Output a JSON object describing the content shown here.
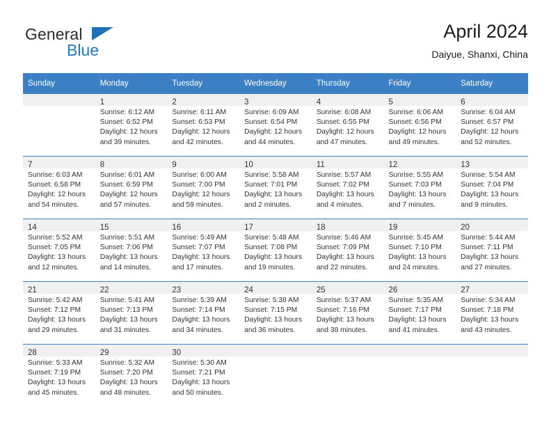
{
  "brand": {
    "line1": "General",
    "line2": "Blue",
    "triangle_icon": "brand-triangle-icon"
  },
  "header": {
    "title": "April 2024",
    "subtitle": "Daiyue, Shanxi, China"
  },
  "colors": {
    "header_blue": "#3b7fc4",
    "brand_blue": "#2079c4",
    "daynum_band": "#f0f0f0",
    "text": "#333333"
  },
  "weekday_headers": [
    "Sunday",
    "Monday",
    "Tuesday",
    "Wednesday",
    "Thursday",
    "Friday",
    "Saturday"
  ],
  "labels": {
    "sunrise_prefix": "Sunrise:",
    "sunset_prefix": "Sunset:",
    "daylight_prefix": "Daylight:"
  },
  "weeks": [
    [
      {
        "day": "",
        "sunrise": "",
        "sunset": "",
        "daylight1": "",
        "daylight2": ""
      },
      {
        "day": "1",
        "sunrise": "Sunrise: 6:12 AM",
        "sunset": "Sunset: 6:52 PM",
        "daylight1": "Daylight: 12 hours",
        "daylight2": "and 39 minutes."
      },
      {
        "day": "2",
        "sunrise": "Sunrise: 6:11 AM",
        "sunset": "Sunset: 6:53 PM",
        "daylight1": "Daylight: 12 hours",
        "daylight2": "and 42 minutes."
      },
      {
        "day": "3",
        "sunrise": "Sunrise: 6:09 AM",
        "sunset": "Sunset: 6:54 PM",
        "daylight1": "Daylight: 12 hours",
        "daylight2": "and 44 minutes."
      },
      {
        "day": "4",
        "sunrise": "Sunrise: 6:08 AM",
        "sunset": "Sunset: 6:55 PM",
        "daylight1": "Daylight: 12 hours",
        "daylight2": "and 47 minutes."
      },
      {
        "day": "5",
        "sunrise": "Sunrise: 6:06 AM",
        "sunset": "Sunset: 6:56 PM",
        "daylight1": "Daylight: 12 hours",
        "daylight2": "and 49 minutes."
      },
      {
        "day": "6",
        "sunrise": "Sunrise: 6:04 AM",
        "sunset": "Sunset: 6:57 PM",
        "daylight1": "Daylight: 12 hours",
        "daylight2": "and 52 minutes."
      }
    ],
    [
      {
        "day": "7",
        "sunrise": "Sunrise: 6:03 AM",
        "sunset": "Sunset: 6:58 PM",
        "daylight1": "Daylight: 12 hours",
        "daylight2": "and 54 minutes."
      },
      {
        "day": "8",
        "sunrise": "Sunrise: 6:01 AM",
        "sunset": "Sunset: 6:59 PM",
        "daylight1": "Daylight: 12 hours",
        "daylight2": "and 57 minutes."
      },
      {
        "day": "9",
        "sunrise": "Sunrise: 6:00 AM",
        "sunset": "Sunset: 7:00 PM",
        "daylight1": "Daylight: 12 hours",
        "daylight2": "and 59 minutes."
      },
      {
        "day": "10",
        "sunrise": "Sunrise: 5:58 AM",
        "sunset": "Sunset: 7:01 PM",
        "daylight1": "Daylight: 13 hours",
        "daylight2": "and 2 minutes."
      },
      {
        "day": "11",
        "sunrise": "Sunrise: 5:57 AM",
        "sunset": "Sunset: 7:02 PM",
        "daylight1": "Daylight: 13 hours",
        "daylight2": "and 4 minutes."
      },
      {
        "day": "12",
        "sunrise": "Sunrise: 5:55 AM",
        "sunset": "Sunset: 7:03 PM",
        "daylight1": "Daylight: 13 hours",
        "daylight2": "and 7 minutes."
      },
      {
        "day": "13",
        "sunrise": "Sunrise: 5:54 AM",
        "sunset": "Sunset: 7:04 PM",
        "daylight1": "Daylight: 13 hours",
        "daylight2": "and 9 minutes."
      }
    ],
    [
      {
        "day": "14",
        "sunrise": "Sunrise: 5:52 AM",
        "sunset": "Sunset: 7:05 PM",
        "daylight1": "Daylight: 13 hours",
        "daylight2": "and 12 minutes."
      },
      {
        "day": "15",
        "sunrise": "Sunrise: 5:51 AM",
        "sunset": "Sunset: 7:06 PM",
        "daylight1": "Daylight: 13 hours",
        "daylight2": "and 14 minutes."
      },
      {
        "day": "16",
        "sunrise": "Sunrise: 5:49 AM",
        "sunset": "Sunset: 7:07 PM",
        "daylight1": "Daylight: 13 hours",
        "daylight2": "and 17 minutes."
      },
      {
        "day": "17",
        "sunrise": "Sunrise: 5:48 AM",
        "sunset": "Sunset: 7:08 PM",
        "daylight1": "Daylight: 13 hours",
        "daylight2": "and 19 minutes."
      },
      {
        "day": "18",
        "sunrise": "Sunrise: 5:46 AM",
        "sunset": "Sunset: 7:09 PM",
        "daylight1": "Daylight: 13 hours",
        "daylight2": "and 22 minutes."
      },
      {
        "day": "19",
        "sunrise": "Sunrise: 5:45 AM",
        "sunset": "Sunset: 7:10 PM",
        "daylight1": "Daylight: 13 hours",
        "daylight2": "and 24 minutes."
      },
      {
        "day": "20",
        "sunrise": "Sunrise: 5:44 AM",
        "sunset": "Sunset: 7:11 PM",
        "daylight1": "Daylight: 13 hours",
        "daylight2": "and 27 minutes."
      }
    ],
    [
      {
        "day": "21",
        "sunrise": "Sunrise: 5:42 AM",
        "sunset": "Sunset: 7:12 PM",
        "daylight1": "Daylight: 13 hours",
        "daylight2": "and 29 minutes."
      },
      {
        "day": "22",
        "sunrise": "Sunrise: 5:41 AM",
        "sunset": "Sunset: 7:13 PM",
        "daylight1": "Daylight: 13 hours",
        "daylight2": "and 31 minutes."
      },
      {
        "day": "23",
        "sunrise": "Sunrise: 5:39 AM",
        "sunset": "Sunset: 7:14 PM",
        "daylight1": "Daylight: 13 hours",
        "daylight2": "and 34 minutes."
      },
      {
        "day": "24",
        "sunrise": "Sunrise: 5:38 AM",
        "sunset": "Sunset: 7:15 PM",
        "daylight1": "Daylight: 13 hours",
        "daylight2": "and 36 minutes."
      },
      {
        "day": "25",
        "sunrise": "Sunrise: 5:37 AM",
        "sunset": "Sunset: 7:16 PM",
        "daylight1": "Daylight: 13 hours",
        "daylight2": "and 38 minutes."
      },
      {
        "day": "26",
        "sunrise": "Sunrise: 5:35 AM",
        "sunset": "Sunset: 7:17 PM",
        "daylight1": "Daylight: 13 hours",
        "daylight2": "and 41 minutes."
      },
      {
        "day": "27",
        "sunrise": "Sunrise: 5:34 AM",
        "sunset": "Sunset: 7:18 PM",
        "daylight1": "Daylight: 13 hours",
        "daylight2": "and 43 minutes."
      }
    ],
    [
      {
        "day": "28",
        "sunrise": "Sunrise: 5:33 AM",
        "sunset": "Sunset: 7:19 PM",
        "daylight1": "Daylight: 13 hours",
        "daylight2": "and 45 minutes."
      },
      {
        "day": "29",
        "sunrise": "Sunrise: 5:32 AM",
        "sunset": "Sunset: 7:20 PM",
        "daylight1": "Daylight: 13 hours",
        "daylight2": "and 48 minutes."
      },
      {
        "day": "30",
        "sunrise": "Sunrise: 5:30 AM",
        "sunset": "Sunset: 7:21 PM",
        "daylight1": "Daylight: 13 hours",
        "daylight2": "and 50 minutes."
      },
      {
        "day": "",
        "sunrise": "",
        "sunset": "",
        "daylight1": "",
        "daylight2": ""
      },
      {
        "day": "",
        "sunrise": "",
        "sunset": "",
        "daylight1": "",
        "daylight2": ""
      },
      {
        "day": "",
        "sunrise": "",
        "sunset": "",
        "daylight1": "",
        "daylight2": ""
      },
      {
        "day": "",
        "sunrise": "",
        "sunset": "",
        "daylight1": "",
        "daylight2": ""
      }
    ]
  ]
}
